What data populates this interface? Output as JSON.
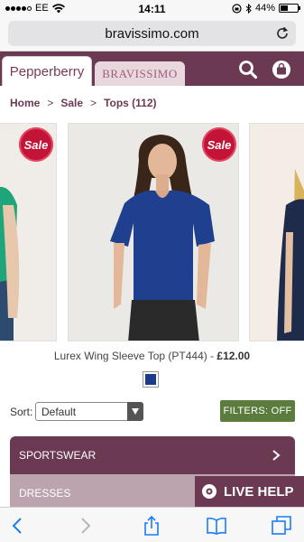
{
  "status_bar": {
    "carrier": "EE",
    "time": "14:11",
    "battery": "44%",
    "battery_level": 0.44
  },
  "browser": {
    "url": "bravissimo.com"
  },
  "brand_tabs": {
    "pepperberry": "Pepperberry",
    "bravissimo": "BRAVISSIMO"
  },
  "breadcrumb": {
    "home": "Home",
    "sale": "Sale",
    "tops": "Tops (112)",
    "separator": ">"
  },
  "carousel": {
    "sale_badge": "Sale",
    "product_name": "Lurex Wing Sleeve Top (PT444) - ",
    "price": "£12.00",
    "swatch_color": "#1e3a8a"
  },
  "sort": {
    "label": "Sort:",
    "selected": "Default"
  },
  "filters": {
    "label": "FILTERS: OFF"
  },
  "categories": [
    {
      "label": "SPORTSWEAR"
    },
    {
      "label": "DRESSES"
    }
  ],
  "live_help": {
    "label": "LIVE HELP"
  },
  "colors": {
    "brand_plum": "#6b3a52",
    "sale_red": "#c31336",
    "filters_green": "#5b7c3d"
  }
}
